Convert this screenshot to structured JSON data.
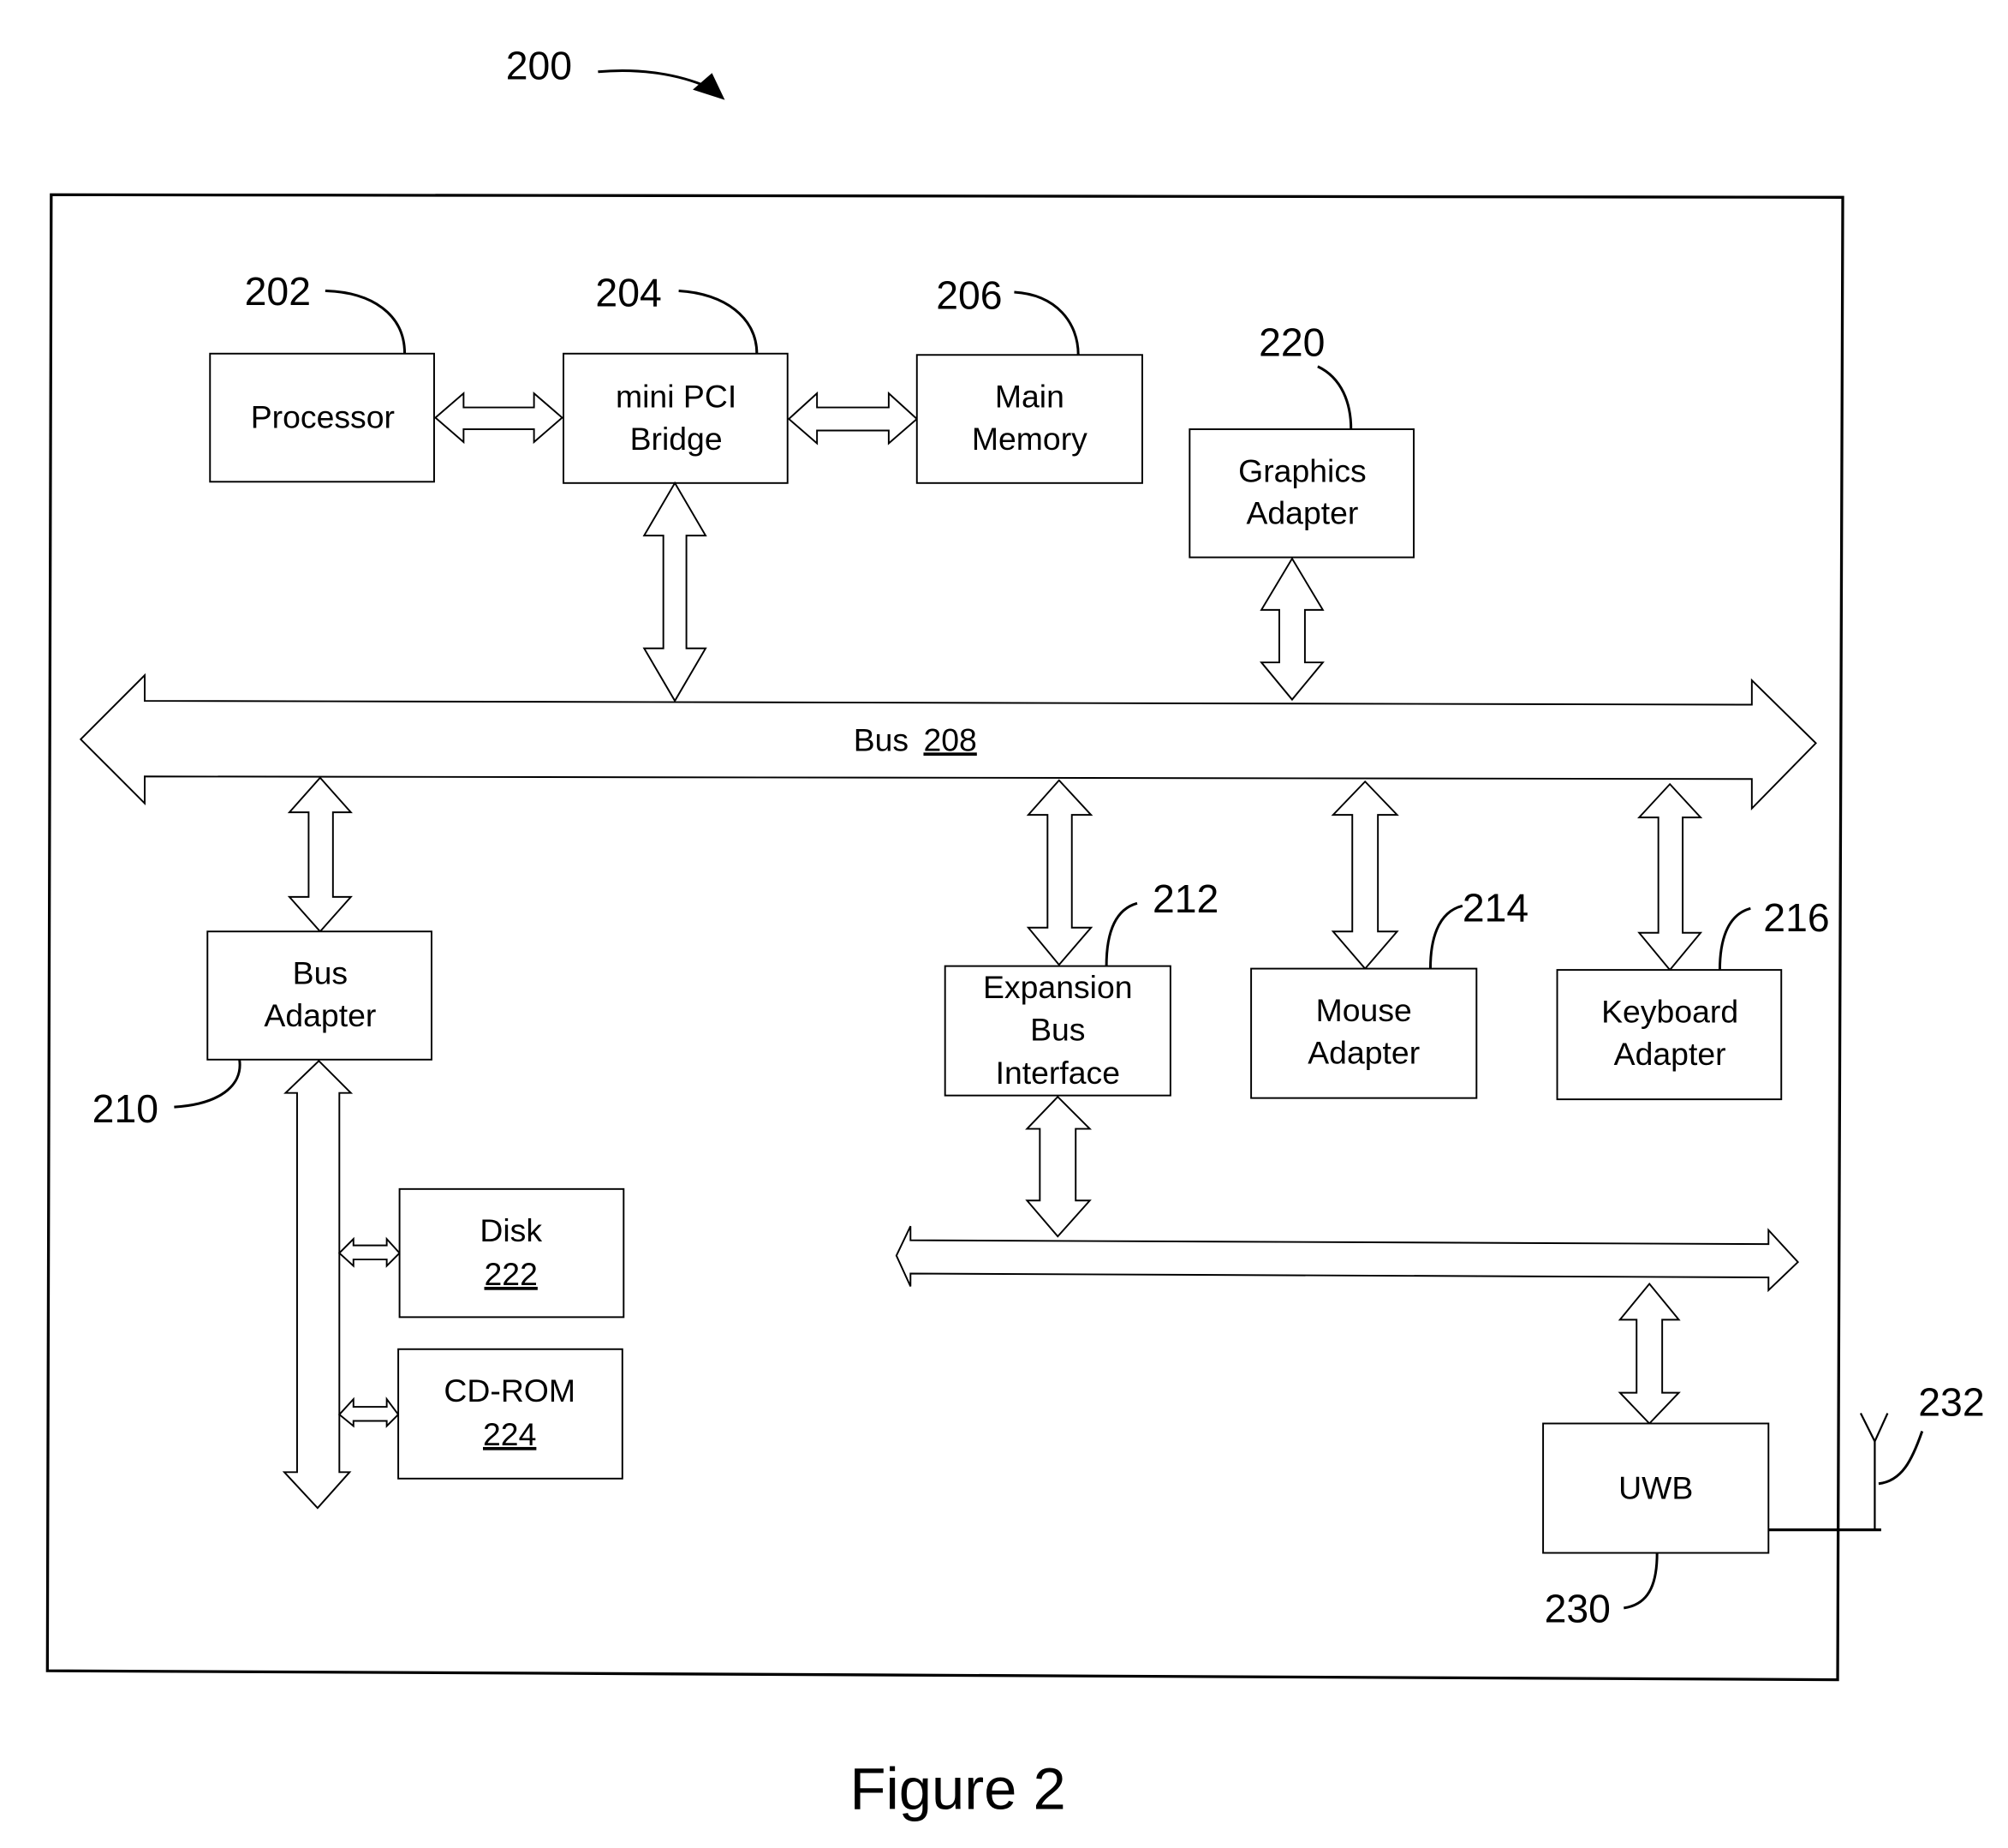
{
  "figure": {
    "reference": "200",
    "caption": "Figure 2"
  },
  "blocks": {
    "processor": {
      "label": "Processor",
      "ref": "202"
    },
    "mini_pci_bridge": {
      "line1": "mini PCI",
      "line2": "Bridge",
      "ref": "204"
    },
    "main_memory": {
      "line1": "Main",
      "line2": "Memory",
      "ref": "206"
    },
    "graphics_adapter": {
      "line1": "Graphics",
      "line2": "Adapter",
      "ref": "220"
    },
    "bus": {
      "label": "Bus",
      "ref": "208"
    },
    "bus_adapter": {
      "line1": "Bus",
      "line2": "Adapter",
      "ref": "210"
    },
    "expansion_bus_interface": {
      "line1": "Expansion",
      "line2": "Bus",
      "line3": "Interface",
      "ref": "212"
    },
    "mouse_adapter": {
      "line1": "Mouse",
      "line2": "Adapter",
      "ref": "214"
    },
    "keyboard_adapter": {
      "line1": "Keyboard",
      "line2": "Adapter",
      "ref": "216"
    },
    "disk": {
      "label": "Disk",
      "ref": "222"
    },
    "cdrom": {
      "label": "CD-ROM",
      "ref": "224"
    },
    "uwb": {
      "label": "UWB",
      "ref": "230"
    },
    "antenna": {
      "ref": "232"
    }
  }
}
